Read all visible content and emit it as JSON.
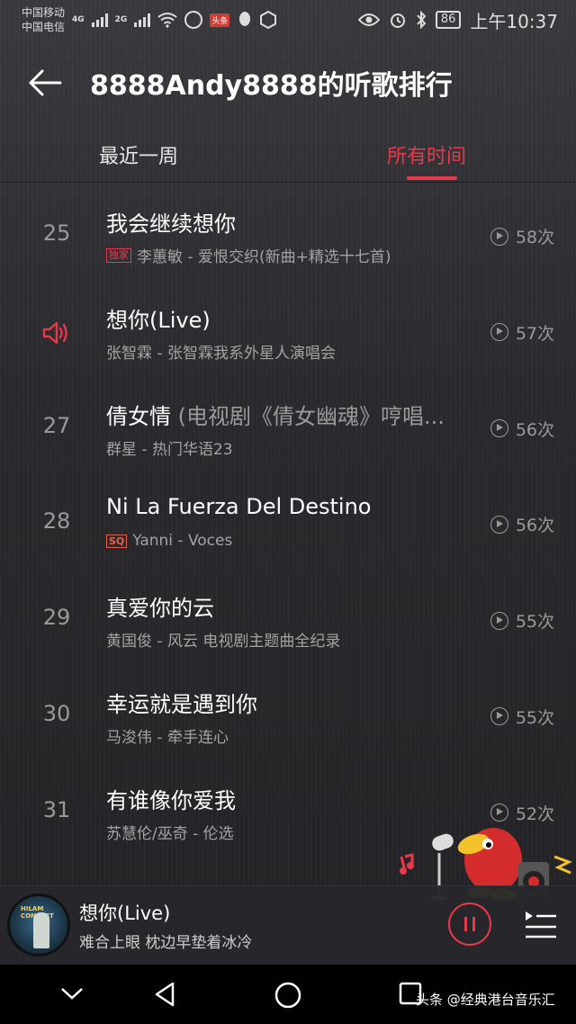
{
  "status_bar": {
    "carrier1": "中国移动",
    "carrier2": "中国电信",
    "net1": "4G",
    "net2": "2G",
    "battery": "86",
    "time": "上午10:37"
  },
  "header": {
    "title": "8888Andy8888的听歌排行"
  },
  "tabs": {
    "week": "最近一周",
    "all": "所有时间",
    "active": "all"
  },
  "rows": [
    {
      "rank": "25",
      "song": "我会继续想你",
      "song_extra": "",
      "badge": "独家",
      "meta": "李蕙敏 - 爱恨交织(新曲+精选十七首)",
      "plays": "58次"
    },
    {
      "rank": "",
      "playing": true,
      "song": "想你(Live)",
      "song_extra": "",
      "badge": "",
      "meta": "张智霖 - 张智霖我系外星人演唱会",
      "plays": "57次"
    },
    {
      "rank": "27",
      "song": "倩女情",
      "song_extra": " (电视剧《倩女幽魂》哼唱...",
      "badge": "",
      "meta": "群星 - 热门华语23",
      "plays": "56次"
    },
    {
      "rank": "28",
      "song": "Ni La Fuerza Del Destino",
      "song_extra": "",
      "badge": "SQ",
      "meta": "Yanni - Voces",
      "plays": "56次"
    },
    {
      "rank": "29",
      "song": "真爱你的云",
      "song_extra": "",
      "badge": "",
      "meta": "黄国俊 - 风云 电视剧主题曲全纪录",
      "plays": "55次"
    },
    {
      "rank": "30",
      "song": "幸运就是遇到你",
      "song_extra": "",
      "badge": "",
      "meta": "马浚伟 - 牵手连心",
      "plays": "55次"
    },
    {
      "rank": "31",
      "song": "有谁像你爱我",
      "song_extra": "",
      "badge": "",
      "meta": "苏慧伦/巫奇 - 伦选",
      "plays": "52次"
    }
  ],
  "player": {
    "title": "想你(Live)",
    "lyric": "难合上眼 枕边早垫着冰冷",
    "cover_caption": "HILAM CONCERT"
  },
  "watermark": "头条 @经典港台音乐汇",
  "colors": {
    "accent": "#e8394a",
    "background": "#2b2b2f"
  }
}
